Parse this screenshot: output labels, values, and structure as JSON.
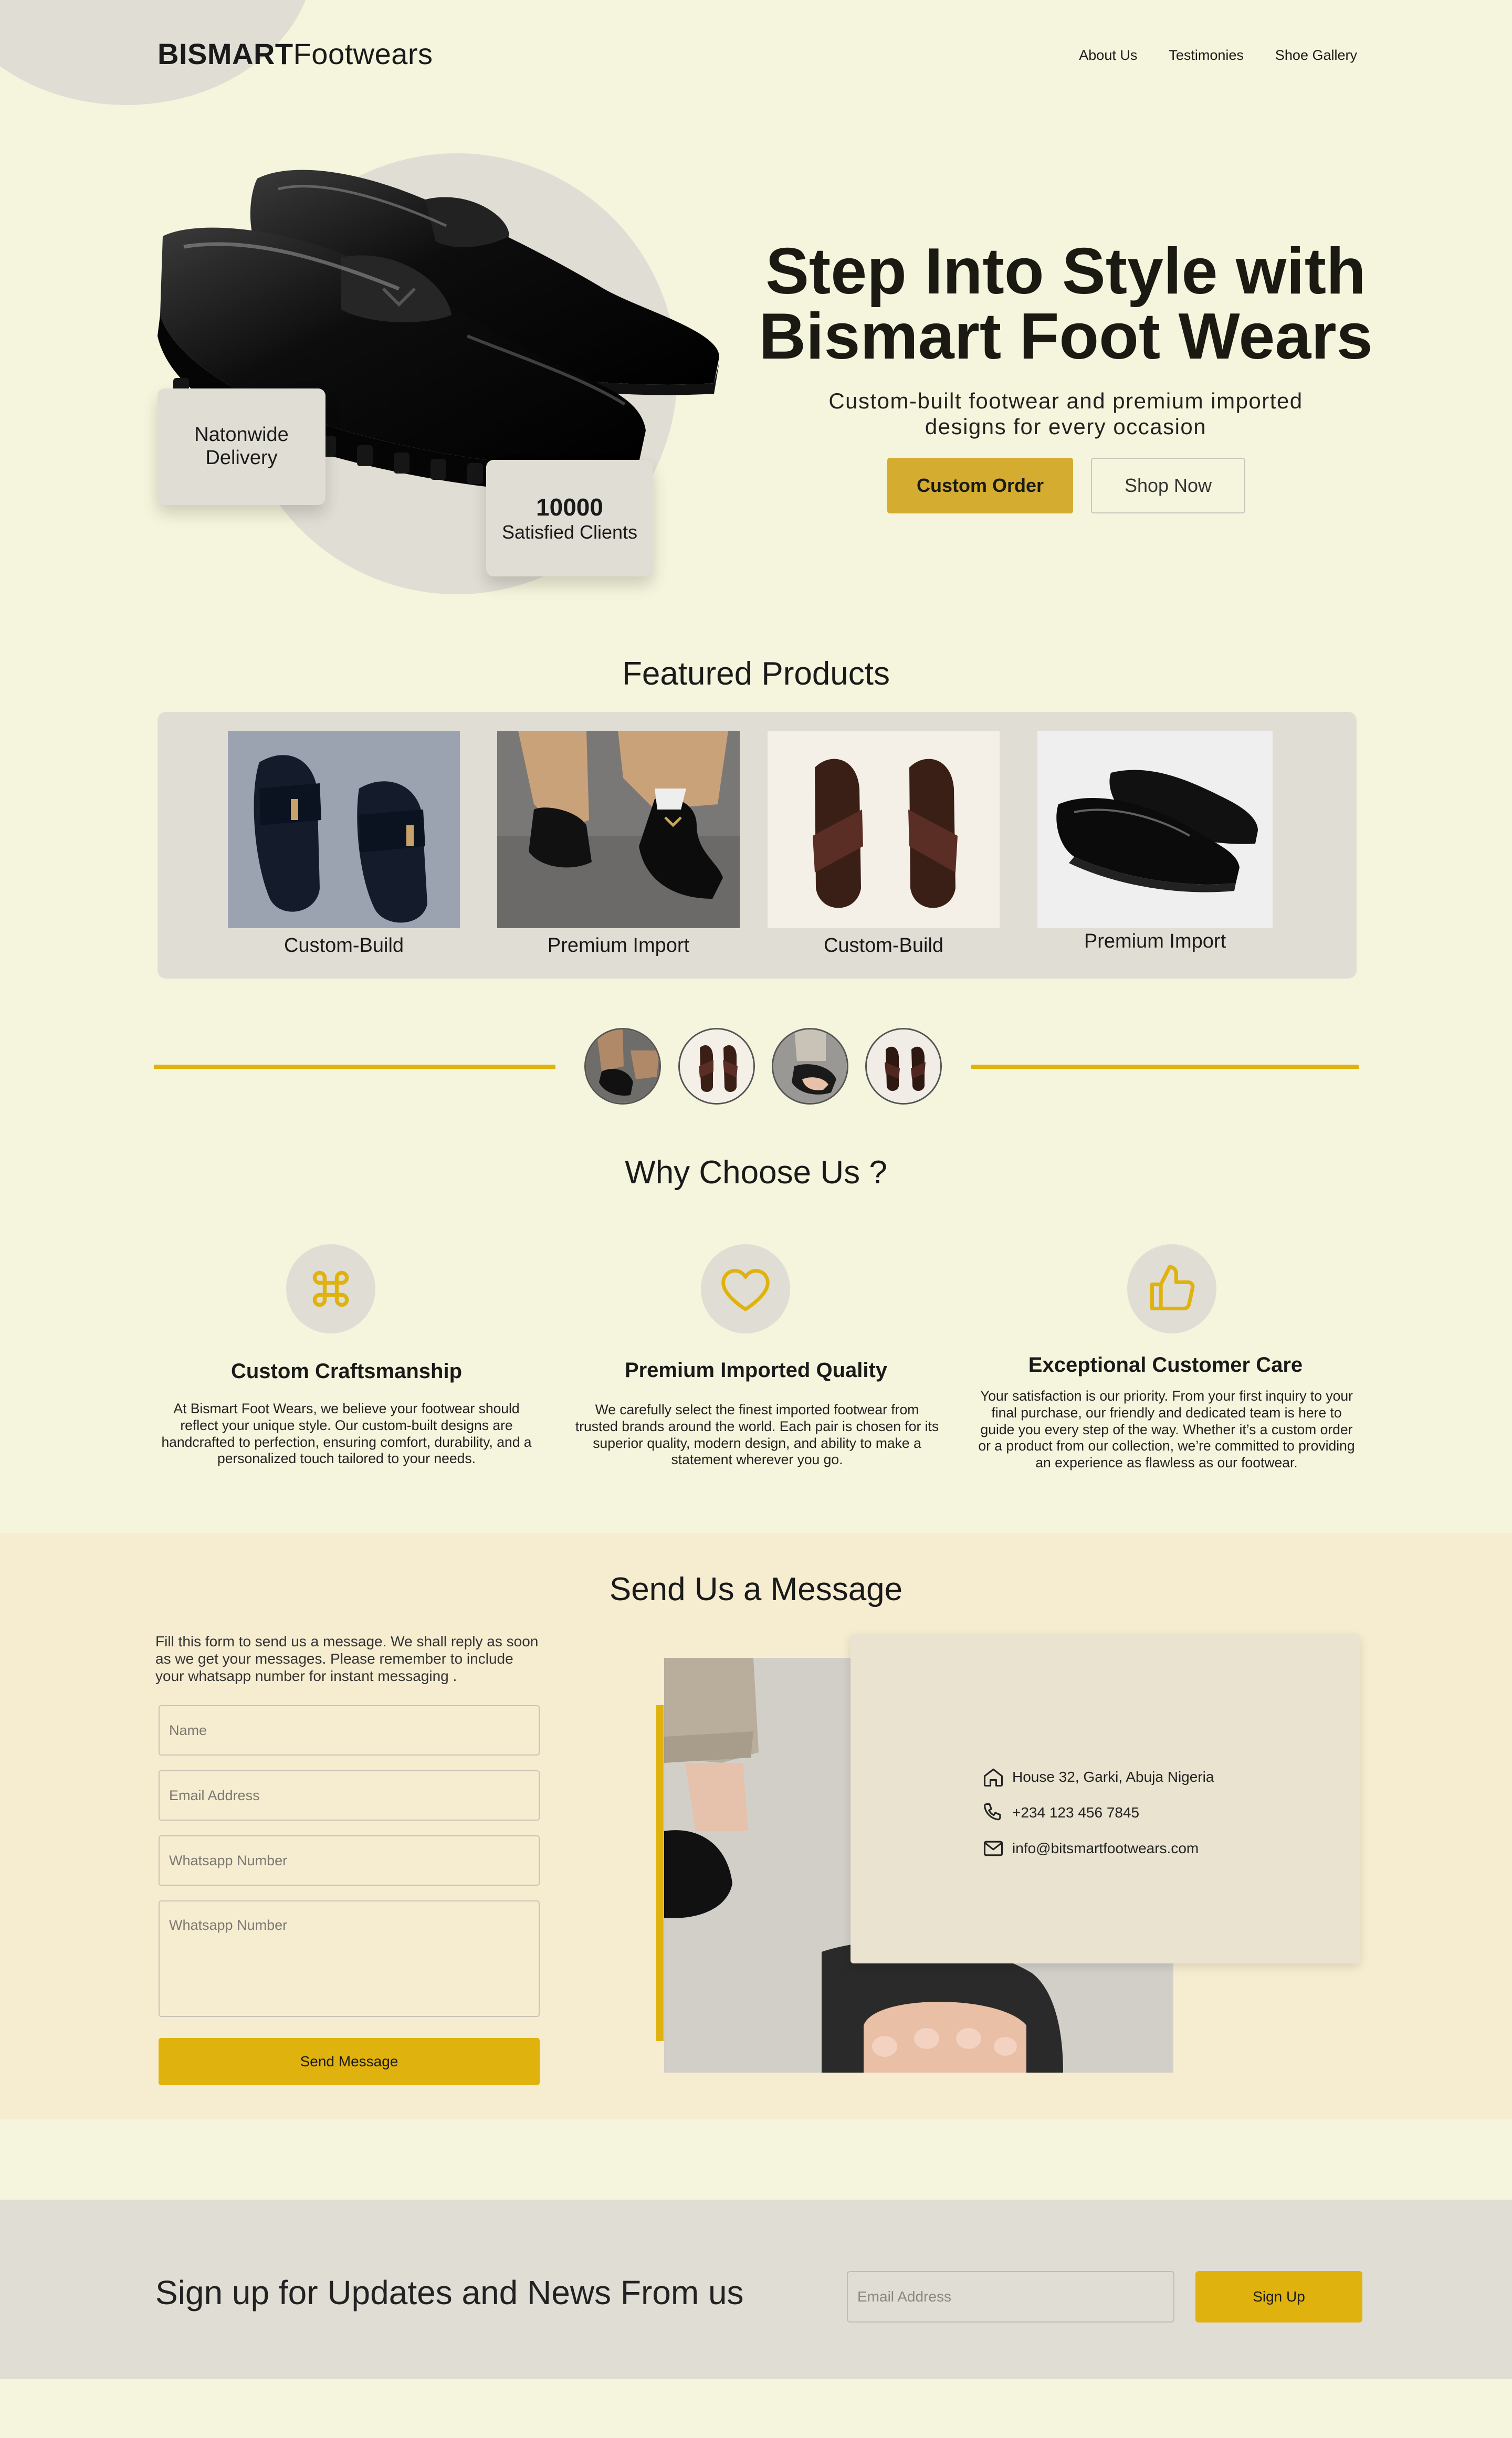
{
  "header": {
    "logo_bold": "BISMART",
    "logo_regular": "Footwears",
    "nav": [
      "About Us",
      "Testimonies",
      "Shoe Gallery"
    ]
  },
  "hero": {
    "title_line1": "Step Into Style with",
    "title_line2": "Bismart Foot Wears",
    "subtitle": "Custom-built footwear and premium imported designs for every occasion",
    "custom_order_label": "Custom Order",
    "shop_now_label": "Shop Now",
    "delivery_line1": "Natonwide",
    "delivery_line2": "Delivery",
    "clients_count": "10000",
    "clients_label": "Satisfied Clients"
  },
  "featured": {
    "title": "Featured Products",
    "products": [
      {
        "caption": "Custom-Build",
        "icon": "black-slides-image"
      },
      {
        "caption": "Premium Import",
        "icon": "loafers-worn-image"
      },
      {
        "caption": "Custom-Build",
        "icon": "brown-sandals-image"
      },
      {
        "caption": "Premium Import",
        "icon": "black-loafers-image"
      }
    ]
  },
  "why": {
    "title": "Why Choose Us ?",
    "items": [
      {
        "icon": "command-icon",
        "title": "Custom Craftsmanship",
        "text": "At Bismart Foot Wears, we believe your footwear should reflect your unique style. Our custom-built designs are handcrafted to perfection, ensuring comfort, durability, and a personalized touch tailored to your needs."
      },
      {
        "icon": "heart-icon",
        "title": "Premium Imported Quality",
        "text": "We carefully select the finest imported footwear from trusted brands around the world. Each pair is chosen for its superior quality, modern design, and ability to make a statement wherever you go."
      },
      {
        "icon": "thumbs-up-icon",
        "title": "Exceptional Customer Care",
        "text": "Your satisfaction is our priority. From your first inquiry to your final purchase, our friendly and dedicated team is here to guide you every step of the way. Whether it’s a custom order or a product from our collection, we’re committed to providing an experience as flawless as our footwear."
      }
    ]
  },
  "contact": {
    "title": "Send Us a Message",
    "intro": "Fill this form to send us a message. We shall reply as soon as we get your messages. Please remember to include your whatsapp number for instant messaging .",
    "name_placeholder": "Name",
    "email_placeholder": "Email Address",
    "whatsapp_placeholder": "Whatsapp Number",
    "message_placeholder": "Whatsapp Number",
    "send_label": "Send Message",
    "address": "House 32, Garki, Abuja Nigeria",
    "phone": "+234 123 456 7845",
    "email": "info@bitsmartfootwears.com"
  },
  "newsletter": {
    "title": "Sign up for Updates and News From us",
    "email_placeholder": "Email Address",
    "signup_label": "Sign Up"
  },
  "colors": {
    "background": "#f5f4dc",
    "accent_gold": "#e0b20e",
    "button_gold": "#d4ad30",
    "panel_gray": "#e0ddd4",
    "contact_band": "#f6ecd0"
  }
}
